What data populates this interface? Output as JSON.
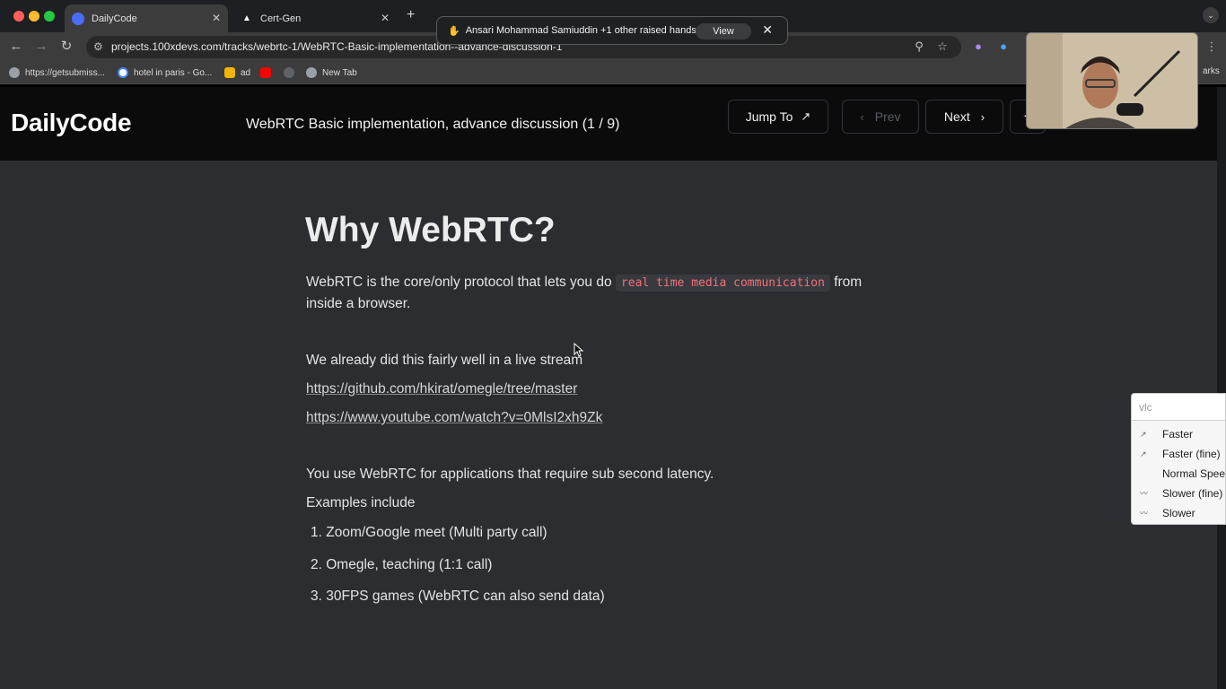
{
  "browser": {
    "tabs": [
      {
        "label": "DailyCode",
        "active": true
      },
      {
        "label": "Cert-Gen",
        "active": false
      }
    ],
    "new_tab": "+",
    "url": "projects.100xdevs.com/tracks/webrtc-1/WebRTC-Basic-implementation--advance-discussion-1",
    "bookmarks": [
      {
        "label": "https://getsubmiss...",
        "icon": "globe-icon"
      },
      {
        "label": "hotel in paris - Go...",
        "icon": "google-icon"
      },
      {
        "label": "ad",
        "icon": "hand-icon"
      },
      {
        "label": "",
        "icon": "youtube-icon"
      },
      {
        "label": "",
        "icon": "settings-icon"
      },
      {
        "label": "New Tab",
        "icon": "globe-icon"
      }
    ],
    "bookmarks_overflow": "arks"
  },
  "meet_banner": {
    "emoji": "✋",
    "text": "Ansari Mohammad Samiuddin +1 other raised hands",
    "view_label": "View",
    "close": "✕"
  },
  "site": {
    "logo": "DailyCode",
    "lesson_title": "WebRTC Basic implementation, advance discussion (1 / 9)",
    "jump_to_label": "Jump To",
    "prev_label": "Prev",
    "next_label": "Next"
  },
  "content": {
    "heading": "Why WebRTC?",
    "para1_before": "WebRTC is the core/only protocol that lets you do",
    "para1_code": "real time media communication",
    "para1_after": "from",
    "para1_line2": "inside a browser.",
    "para2": "We already did this fairly well in a live stream",
    "link1": "https://github.com/hkirat/omegle/tree/master",
    "link2": "https://www.youtube.com/watch?v=0MlsI2xh9Zk",
    "para3": "You use WebRTC for applications that require sub second latency.",
    "para4": "Examples include",
    "list": [
      "Zoom/Google meet (Multi party call)",
      "Omegle, teaching (1:1 call)",
      "30FPS games (WebRTC can also send data)"
    ]
  },
  "vlc_menu": {
    "search_placeholder": "vlc",
    "items": [
      "Faster",
      "Faster (fine)",
      "Normal Speed",
      "Slower (fine)",
      "Slower"
    ]
  },
  "colors": {
    "accent_code": "#f07178",
    "page_bg": "#2b2d31",
    "header_bg": "#0b0b0c"
  }
}
